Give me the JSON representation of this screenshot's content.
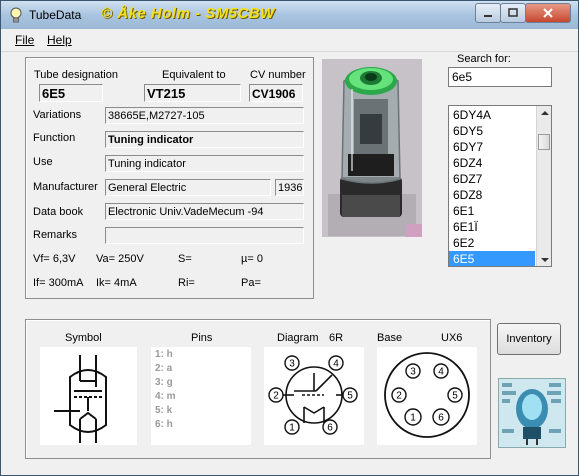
{
  "window": {
    "title": "TubeData",
    "author": "© Åke Holm - SM5CBW"
  },
  "menu": {
    "file": "File",
    "help": "Help"
  },
  "header_labels": {
    "designation": "Tube designation",
    "equivalent": "Equivalent to",
    "cv": "CV number"
  },
  "tube": {
    "designation": "6E5",
    "equivalent": "VT215",
    "cv": "CV1906",
    "variations": "38665E,M2727-105",
    "function": "Tuning indicator",
    "use": "Tuning indicator",
    "manufacturer": "General Electric",
    "year": "1936",
    "databook": "Electronic Univ.VadeMecum -94",
    "remarks": ""
  },
  "row_labels": {
    "variations": "Variations",
    "function": "Function",
    "use": "Use",
    "manufacturer": "Manufacturer",
    "databook": "Data book",
    "remarks": "Remarks"
  },
  "params": {
    "vf": "Vf= 6,3V",
    "va": "Va=  250V",
    "s": "S=",
    "mu": "µ=    0",
    "if": "If= 300mA",
    "ik": "Ik=   4mA",
    "ri": "Ri=",
    "pa": "Pa="
  },
  "search": {
    "label": "Search for:",
    "value": "6e5"
  },
  "tube_list": [
    "6DY4A",
    "6DY5",
    "6DY7",
    "6DZ4",
    "6DZ7",
    "6DZ8",
    "6E1",
    "6E1Ï",
    "6E2",
    "6E5"
  ],
  "selected_tube": "6E5",
  "bottom": {
    "symbol": "Symbol",
    "pins": "Pins",
    "diagram": "Diagram",
    "diagram_code": "6R",
    "base": "Base",
    "base_code": "UX6"
  },
  "pins_list": [
    "1: h",
    "2: a",
    "3: g",
    "4: m",
    "5: k",
    "6: h"
  ],
  "diagram_pins": [
    "1",
    "2",
    "3",
    "4",
    "5",
    "6"
  ],
  "base_pins": [
    "1",
    "2",
    "3",
    "4",
    "5",
    "6"
  ],
  "inventory_button": "Inventory",
  "colors": {
    "selection": "#3399ff",
    "author": "#f4e020",
    "glow": "#35d05a"
  }
}
